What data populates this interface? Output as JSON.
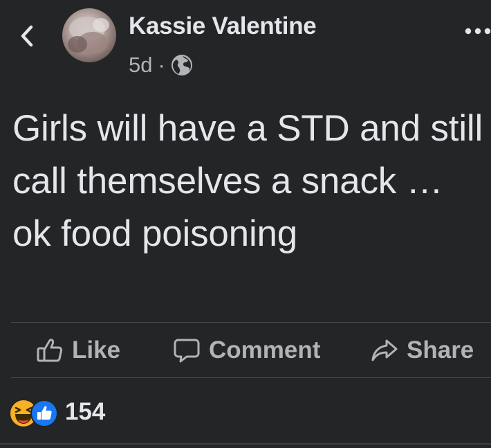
{
  "post": {
    "author": "Kassie Valentine",
    "time": "5d",
    "separator": "·",
    "privacy_icon": "globe-icon",
    "text": "Girls will have a STD and still call themselves a snack … ok food poisoning"
  },
  "actions": {
    "like_label": "Like",
    "comment_label": "Comment",
    "share_label": "Share"
  },
  "reactions": {
    "types": [
      "haha",
      "like"
    ],
    "count": "154"
  },
  "colors": {
    "background": "#242526",
    "primary_text": "#e4e6eb",
    "secondary_text": "#b0b3b8",
    "like_blue": "#1877f2",
    "haha_yellow": "#f7b125"
  }
}
